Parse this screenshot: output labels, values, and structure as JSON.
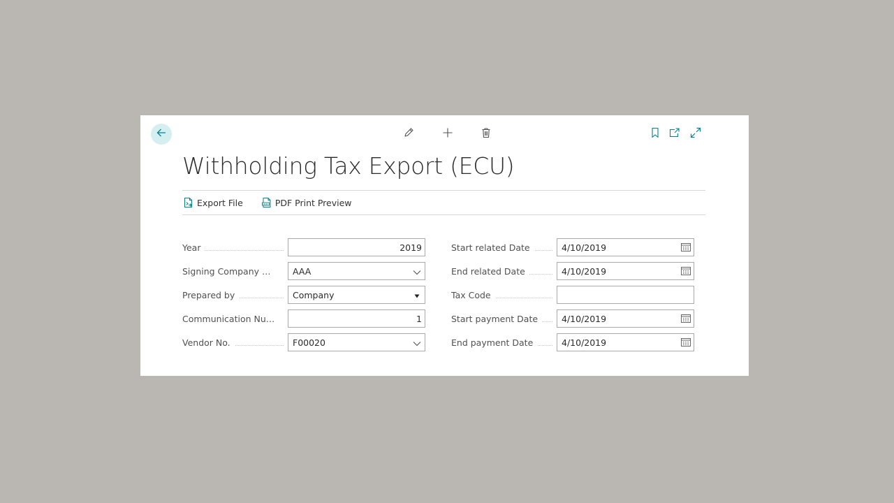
{
  "page": {
    "title": "Withholding Tax Export (ECU)"
  },
  "actions": [
    {
      "label": "Export File",
      "icon": "export-file-icon"
    },
    {
      "label": "PDF Print Preview",
      "icon": "pdf-document-icon"
    }
  ],
  "left_fields": [
    {
      "label": "Year",
      "value": "2019",
      "type": "number"
    },
    {
      "label": "Signing Company Offi...",
      "value": "AAA",
      "type": "lookup"
    },
    {
      "label": "Prepared by",
      "value": "Company",
      "type": "option"
    },
    {
      "label": "Communication Num...",
      "value": "1",
      "type": "number"
    },
    {
      "label": "Vendor No.",
      "value": "F00020",
      "type": "lookup"
    }
  ],
  "right_fields": [
    {
      "label": "Start related Date",
      "value": "4/10/2019",
      "type": "date"
    },
    {
      "label": "End related Date",
      "value": "4/10/2019",
      "type": "date"
    },
    {
      "label": "Tax Code",
      "value": "",
      "type": "text"
    },
    {
      "label": "Start payment Date",
      "value": "4/10/2019",
      "type": "date"
    },
    {
      "label": "End payment Date",
      "value": "4/10/2019",
      "type": "date"
    }
  ],
  "colors": {
    "accent": "#00838f",
    "page_background": "#bab6b1",
    "back_button_background": "#d5eef0"
  }
}
